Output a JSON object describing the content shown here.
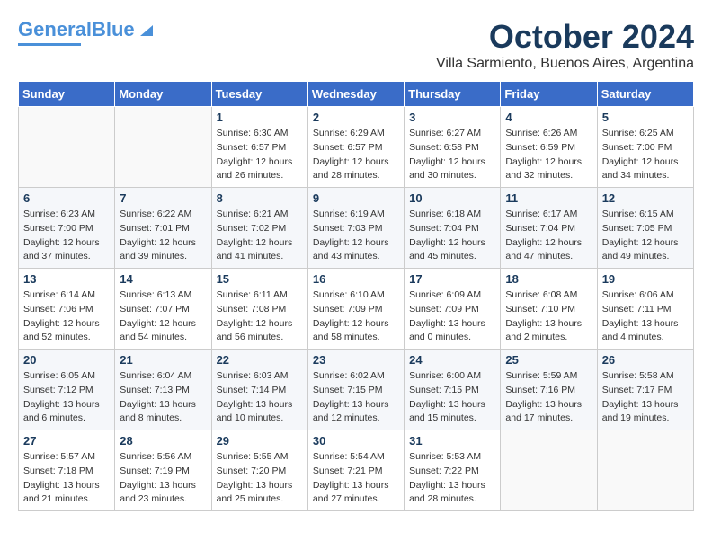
{
  "header": {
    "logo": {
      "part1": "General",
      "part2": "Blue"
    },
    "title": "October 2024",
    "subtitle": "Villa Sarmiento, Buenos Aires, Argentina"
  },
  "calendar": {
    "days_of_week": [
      "Sunday",
      "Monday",
      "Tuesday",
      "Wednesday",
      "Thursday",
      "Friday",
      "Saturday"
    ],
    "weeks": [
      [
        {
          "day": "",
          "info": ""
        },
        {
          "day": "",
          "info": ""
        },
        {
          "day": "1",
          "info": "Sunrise: 6:30 AM\nSunset: 6:57 PM\nDaylight: 12 hours\nand 26 minutes."
        },
        {
          "day": "2",
          "info": "Sunrise: 6:29 AM\nSunset: 6:57 PM\nDaylight: 12 hours\nand 28 minutes."
        },
        {
          "day": "3",
          "info": "Sunrise: 6:27 AM\nSunset: 6:58 PM\nDaylight: 12 hours\nand 30 minutes."
        },
        {
          "day": "4",
          "info": "Sunrise: 6:26 AM\nSunset: 6:59 PM\nDaylight: 12 hours\nand 32 minutes."
        },
        {
          "day": "5",
          "info": "Sunrise: 6:25 AM\nSunset: 7:00 PM\nDaylight: 12 hours\nand 34 minutes."
        }
      ],
      [
        {
          "day": "6",
          "info": "Sunrise: 6:23 AM\nSunset: 7:00 PM\nDaylight: 12 hours\nand 37 minutes."
        },
        {
          "day": "7",
          "info": "Sunrise: 6:22 AM\nSunset: 7:01 PM\nDaylight: 12 hours\nand 39 minutes."
        },
        {
          "day": "8",
          "info": "Sunrise: 6:21 AM\nSunset: 7:02 PM\nDaylight: 12 hours\nand 41 minutes."
        },
        {
          "day": "9",
          "info": "Sunrise: 6:19 AM\nSunset: 7:03 PM\nDaylight: 12 hours\nand 43 minutes."
        },
        {
          "day": "10",
          "info": "Sunrise: 6:18 AM\nSunset: 7:04 PM\nDaylight: 12 hours\nand 45 minutes."
        },
        {
          "day": "11",
          "info": "Sunrise: 6:17 AM\nSunset: 7:04 PM\nDaylight: 12 hours\nand 47 minutes."
        },
        {
          "day": "12",
          "info": "Sunrise: 6:15 AM\nSunset: 7:05 PM\nDaylight: 12 hours\nand 49 minutes."
        }
      ],
      [
        {
          "day": "13",
          "info": "Sunrise: 6:14 AM\nSunset: 7:06 PM\nDaylight: 12 hours\nand 52 minutes."
        },
        {
          "day": "14",
          "info": "Sunrise: 6:13 AM\nSunset: 7:07 PM\nDaylight: 12 hours\nand 54 minutes."
        },
        {
          "day": "15",
          "info": "Sunrise: 6:11 AM\nSunset: 7:08 PM\nDaylight: 12 hours\nand 56 minutes."
        },
        {
          "day": "16",
          "info": "Sunrise: 6:10 AM\nSunset: 7:09 PM\nDaylight: 12 hours\nand 58 minutes."
        },
        {
          "day": "17",
          "info": "Sunrise: 6:09 AM\nSunset: 7:09 PM\nDaylight: 13 hours\nand 0 minutes."
        },
        {
          "day": "18",
          "info": "Sunrise: 6:08 AM\nSunset: 7:10 PM\nDaylight: 13 hours\nand 2 minutes."
        },
        {
          "day": "19",
          "info": "Sunrise: 6:06 AM\nSunset: 7:11 PM\nDaylight: 13 hours\nand 4 minutes."
        }
      ],
      [
        {
          "day": "20",
          "info": "Sunrise: 6:05 AM\nSunset: 7:12 PM\nDaylight: 13 hours\nand 6 minutes."
        },
        {
          "day": "21",
          "info": "Sunrise: 6:04 AM\nSunset: 7:13 PM\nDaylight: 13 hours\nand 8 minutes."
        },
        {
          "day": "22",
          "info": "Sunrise: 6:03 AM\nSunset: 7:14 PM\nDaylight: 13 hours\nand 10 minutes."
        },
        {
          "day": "23",
          "info": "Sunrise: 6:02 AM\nSunset: 7:15 PM\nDaylight: 13 hours\nand 12 minutes."
        },
        {
          "day": "24",
          "info": "Sunrise: 6:00 AM\nSunset: 7:15 PM\nDaylight: 13 hours\nand 15 minutes."
        },
        {
          "day": "25",
          "info": "Sunrise: 5:59 AM\nSunset: 7:16 PM\nDaylight: 13 hours\nand 17 minutes."
        },
        {
          "day": "26",
          "info": "Sunrise: 5:58 AM\nSunset: 7:17 PM\nDaylight: 13 hours\nand 19 minutes."
        }
      ],
      [
        {
          "day": "27",
          "info": "Sunrise: 5:57 AM\nSunset: 7:18 PM\nDaylight: 13 hours\nand 21 minutes."
        },
        {
          "day": "28",
          "info": "Sunrise: 5:56 AM\nSunset: 7:19 PM\nDaylight: 13 hours\nand 23 minutes."
        },
        {
          "day": "29",
          "info": "Sunrise: 5:55 AM\nSunset: 7:20 PM\nDaylight: 13 hours\nand 25 minutes."
        },
        {
          "day": "30",
          "info": "Sunrise: 5:54 AM\nSunset: 7:21 PM\nDaylight: 13 hours\nand 27 minutes."
        },
        {
          "day": "31",
          "info": "Sunrise: 5:53 AM\nSunset: 7:22 PM\nDaylight: 13 hours\nand 28 minutes."
        },
        {
          "day": "",
          "info": ""
        },
        {
          "day": "",
          "info": ""
        }
      ]
    ]
  }
}
